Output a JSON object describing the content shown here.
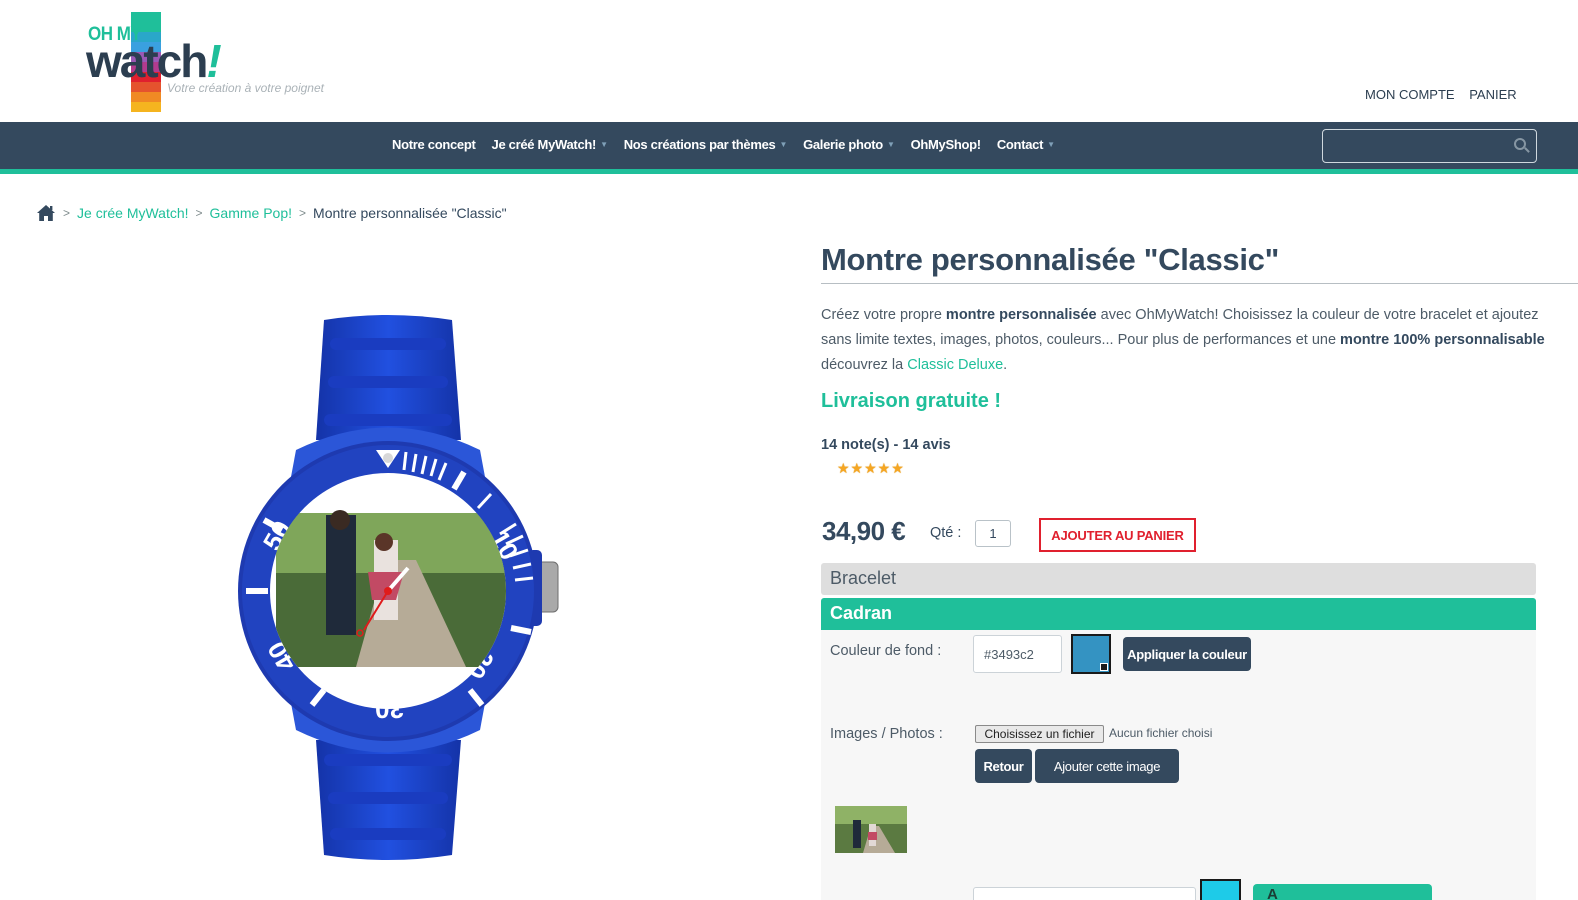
{
  "header": {
    "logo": {
      "brand_top": "OH MY",
      "brand_main": "watch",
      "brand_excl": "!",
      "tagline": "Votre création à votre poignet"
    },
    "links": [
      "MON COMPTE",
      "PANIER"
    ]
  },
  "nav": {
    "items": [
      {
        "label": "Notre concept",
        "dropdown": false
      },
      {
        "label": "Je créé MyWatch!",
        "dropdown": true
      },
      {
        "label": "Nos créations par thèmes",
        "dropdown": true
      },
      {
        "label": "Galerie photo",
        "dropdown": true
      },
      {
        "label": "OhMyShop!",
        "dropdown": false
      },
      {
        "label": "Contact",
        "dropdown": true
      }
    ],
    "search_placeholder": ""
  },
  "breadcrumb": {
    "items": [
      "Je crée MyWatch!",
      "Gamme Pop!"
    ],
    "current": "Montre personnalisée \"Classic\""
  },
  "watch": {
    "bezel_numbers": [
      "10",
      "20",
      "30",
      "40",
      "50"
    ],
    "strap_color": "#1a44c9",
    "bezel_color": "#1e3ab0"
  },
  "product": {
    "title": "Montre personnalisée \"Classic\"",
    "description": {
      "l1a": "Créez votre propre ",
      "l1b": "montre personnalisée",
      "l1c": " avec OhMyWatch! Choisissez la couleur de votre bracelet et ajoutez",
      "l2a": "sans limite textes, images, photos, couleurs... Pour plus de performances et une ",
      "l2b": "montre 100% personnalisable",
      "l3a": "découvrez la ",
      "l3link": "Classic Deluxe",
      "l3b": "."
    },
    "free_shipping": "Livraison gratuite !",
    "reviews": "14 note(s) - 14 avis",
    "rating": 5,
    "stars": "★★★★★",
    "price": "34,90 €",
    "qty_label": "Qté :",
    "qty": "1",
    "add_to_cart": "AJOUTER AU PANIER"
  },
  "customizer": {
    "bracelet_title": "Bracelet",
    "cadran_title": "Cadran",
    "bg_color_label": "Couleur de fond :",
    "bg_color_value": "#3493c2",
    "apply_color": "Appliquer la couleur",
    "images_label": "Images / Photos :",
    "file_button": "Choisissez un fichier",
    "file_none": "Aucun fichier choisi",
    "back": "Retour",
    "add_image": "Ajouter cette image",
    "next_button_partial": "A",
    "next_swatch_color": "#1ecbe8"
  },
  "colors": {
    "accent": "#1fbf9a",
    "nav_bg": "#34495e",
    "cta": "#e0202e",
    "text": "#34495e"
  }
}
